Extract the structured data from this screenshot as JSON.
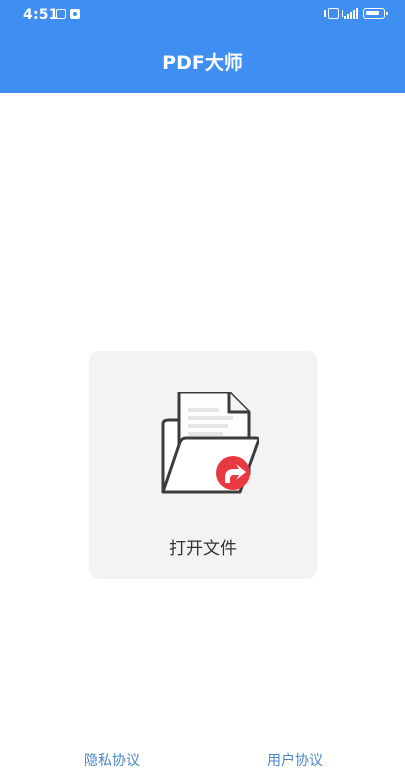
{
  "status_bar": {
    "time": "4:51",
    "left_icons": [
      "app-icon",
      "notification-icon"
    ],
    "right_icons": [
      "vibrate-icon",
      "signal-icon",
      "battery-icon"
    ]
  },
  "header": {
    "title": "PDF大师"
  },
  "open_card": {
    "label": "打开文件",
    "icon": "folder-open-icon"
  },
  "footer": {
    "privacy_link": "隐私协议",
    "user_link": "用户协议"
  },
  "colors": {
    "header_background": "#3f8ff3",
    "card_background": "#f3f3f3",
    "accent_red": "#e93943",
    "link_blue": "#4a86c8"
  }
}
